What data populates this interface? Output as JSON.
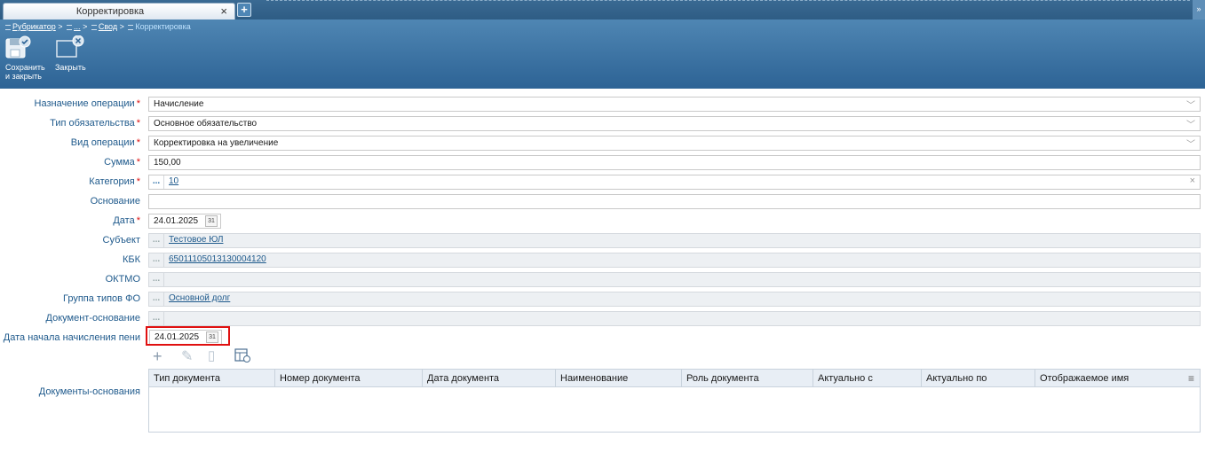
{
  "tab": {
    "title": "Корректировка",
    "close": "×",
    "add": "+"
  },
  "breadcrumb": [
    "Рубрикатор",
    "...",
    "Свод",
    "Корректировка"
  ],
  "toolbar": {
    "save_label": "Сохранить\nи закрыть",
    "close_label": "Закрыть"
  },
  "form": {
    "operation_purpose": {
      "label": "Назначение операции",
      "value": "Начисление"
    },
    "obligation_type": {
      "label": "Тип обязательства",
      "value": "Основное обязательство"
    },
    "operation_kind": {
      "label": "Вид операции",
      "value": "Корректировка на увеличение"
    },
    "amount": {
      "label": "Сумма",
      "value": "150,00"
    },
    "category": {
      "label": "Категория",
      "value": "10"
    },
    "basis": {
      "label": "Основание",
      "value": ""
    },
    "date": {
      "label": "Дата",
      "value": "24.01.2025"
    },
    "subject": {
      "label": "Субъект",
      "value": "Тестовое ЮЛ"
    },
    "kbk": {
      "label": "КБК",
      "value": "65011105013130004120"
    },
    "oktmo": {
      "label": "ОКТМО",
      "value": ""
    },
    "fo_group": {
      "label": "Группа типов ФО",
      "value": "Основной долг"
    },
    "basis_doc": {
      "label": "Документ-основание",
      "value": ""
    },
    "penalty_start": {
      "label": "Дата начала начисления пени",
      "value": "24.01.2025"
    },
    "basis_docs": {
      "label": "Документы-основания"
    }
  },
  "required_mark": "*",
  "calendar_label": "31",
  "dots": "...",
  "grid": {
    "columns": [
      "Тип документа",
      "Номер документа",
      "Дата документа",
      "Наименование",
      "Роль документа",
      "Актуально с",
      "Актуально по",
      "Отображаемое имя"
    ],
    "menu": "≡"
  },
  "icons": {
    "add": "plus-icon",
    "edit": "pencil-icon",
    "delete": "trash-icon",
    "export": "table-export-icon"
  }
}
